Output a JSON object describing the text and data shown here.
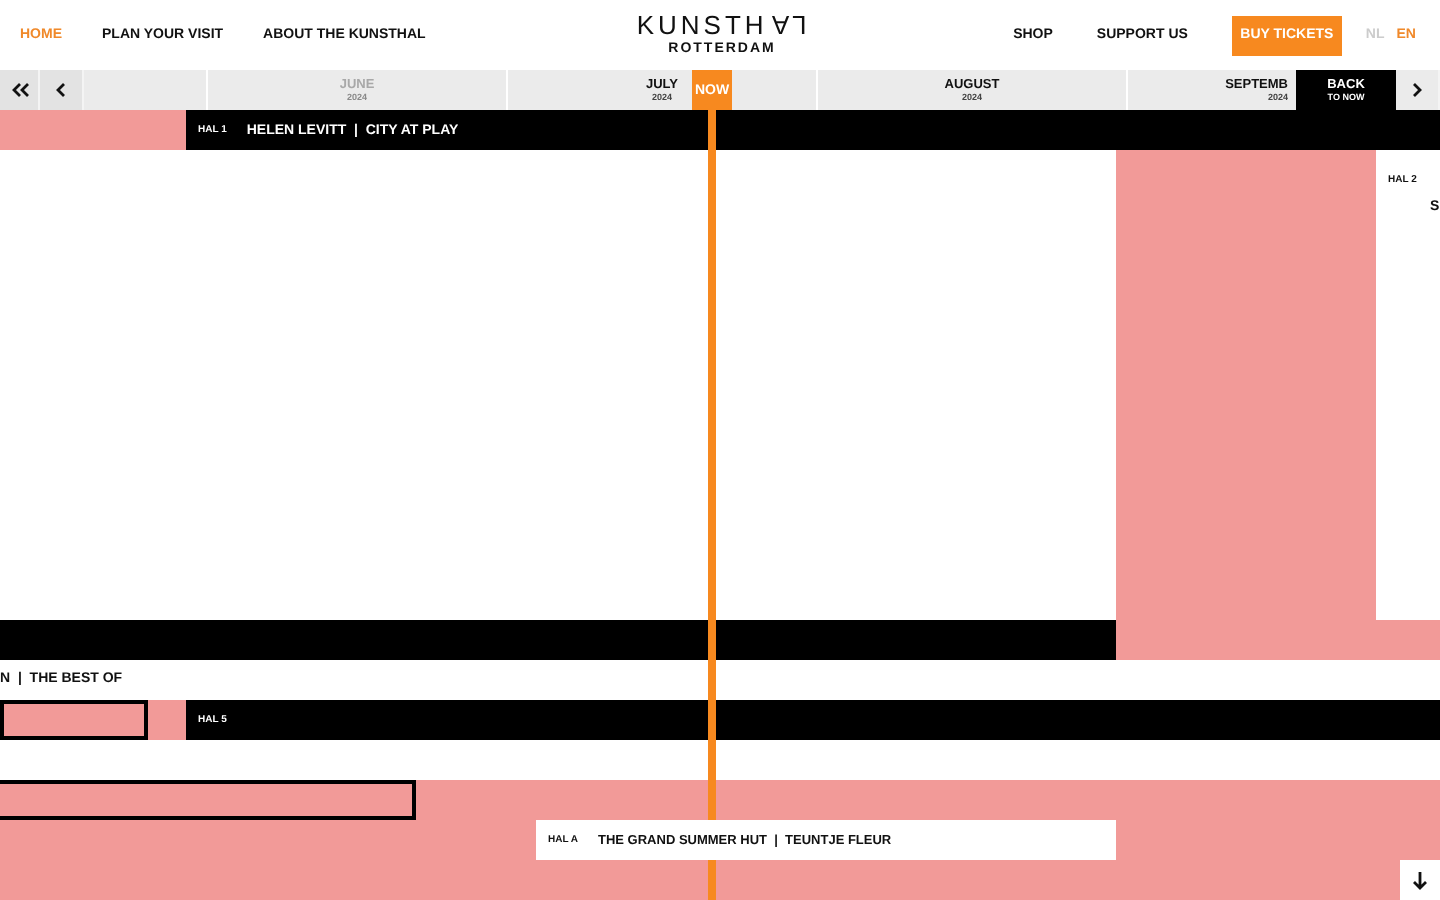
{
  "nav": [
    {
      "label": "HOME",
      "selected": true
    },
    {
      "label": "PLAN YOUR VISIT",
      "selected": false
    },
    {
      "label": "ABOUT THE KUNSTHAL",
      "selected": false
    }
  ],
  "logo": {
    "name": "KUNSTHAL",
    "city": "ROTTERDAM"
  },
  "utility_nav": [
    "SHOP",
    "SUPPORT US"
  ],
  "buy_button": "BUY TICKETS",
  "languages": [
    {
      "label": "NL",
      "selected": false
    },
    {
      "label": "EN",
      "selected": true
    }
  ],
  "now_marker": "NOW",
  "back_to_now": {
    "title": "BACK",
    "subtitle": "TO NOW"
  },
  "months": [
    {
      "name": "JUNE",
      "year": "2024",
      "past": true
    },
    {
      "name": "JULY",
      "year": "2024",
      "past": false
    },
    {
      "name": "AUGUST",
      "year": "2024",
      "past": false
    },
    {
      "name": "SEPTEMB",
      "year": "2024",
      "past": false
    }
  ],
  "exhibitions": [
    {
      "hall": "HAL 1",
      "title": "HELEN LEVITT  |  CITY AT PLAY"
    },
    {
      "hall": "HAL 2",
      "title": "S"
    },
    {
      "title": "N  |  THE BEST OF"
    },
    {
      "hall": "HAL 5"
    },
    {
      "hall": "HAL A",
      "title": "THE GRAND SUMMER HUT  |  TEUNTJE FLEUR"
    }
  ]
}
